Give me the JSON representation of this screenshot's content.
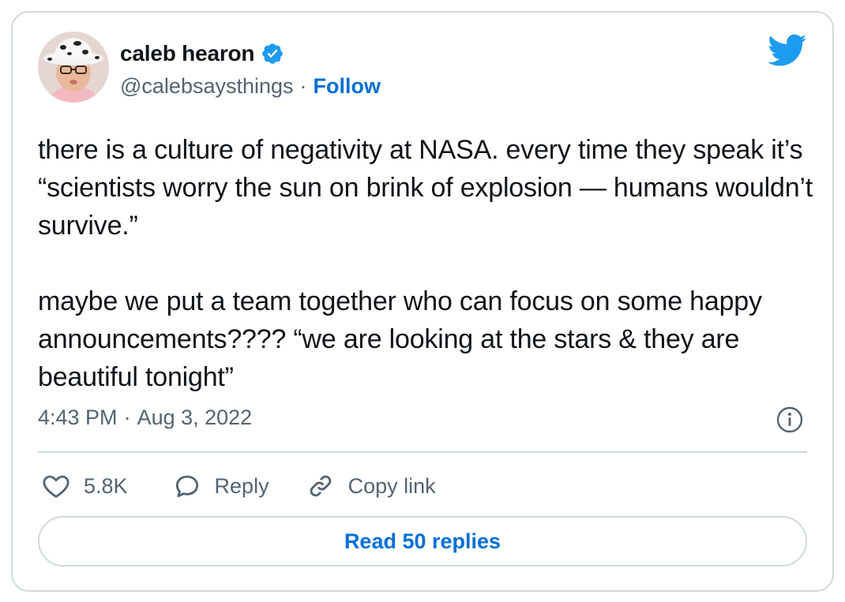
{
  "author": {
    "name": "caleb hearon",
    "handle": "@calebsaysthings",
    "separator": "·",
    "follow_label": "Follow",
    "verified": true
  },
  "tweet": {
    "paragraphs": [
      "there is a culture of negativity at NASA. every time they speak it’s “scientists worry the sun on brink of explosion — humans wouldn’t survive.”",
      "maybe we put a team together who can focus on some happy announcements???? “we are looking at the stars & they are beautiful tonight”"
    ]
  },
  "meta": {
    "time": "4:43 PM",
    "separator": "·",
    "date": "Aug 3, 2022"
  },
  "actions": {
    "like_count": "5.8K",
    "reply_label": "Reply",
    "copy_link_label": "Copy link"
  },
  "read_replies_label": "Read 50 replies",
  "colors": {
    "accent": "#006fd6",
    "twitter_blue": "#1d9bf0",
    "secondary_text": "#536471",
    "border": "#cfd9de"
  },
  "icons": {
    "brand": "twitter-bird-icon",
    "verified": "verified-badge-icon",
    "info": "info-icon",
    "like": "heart-icon",
    "reply": "speech-bubble-icon",
    "copy": "link-icon"
  }
}
